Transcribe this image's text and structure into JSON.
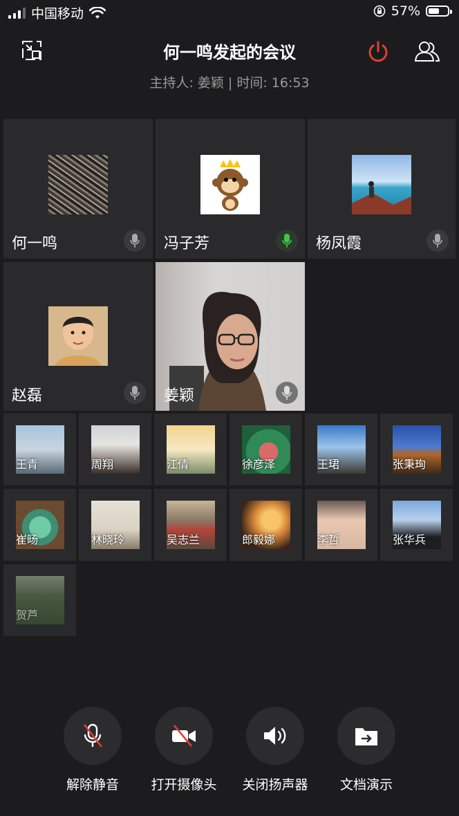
{
  "status_bar": {
    "carrier": "中国移动",
    "battery": "57%",
    "battery_level": 0.57
  },
  "header": {
    "title": "何一鸣发起的会议",
    "subtitle": "主持人: 姜颖 | 时间: 16:53"
  },
  "colors": {
    "accent_red": "#e0412f",
    "active_green": "#3cc84a",
    "bg": "#1c1c1e",
    "tile": "#2a2a2c"
  },
  "main_participants": [
    {
      "name": "何一鸣",
      "mic": "muted"
    },
    {
      "name": "冯子芳",
      "mic": "active"
    },
    {
      "name": "杨凤霞",
      "mic": "muted"
    },
    {
      "name": "赵磊",
      "mic": "muted"
    },
    {
      "name": "姜颖",
      "mic": "muted",
      "video": true
    }
  ],
  "grid_participants": [
    "王青",
    "周翔",
    "江倩",
    "徐彦泽",
    "王珺",
    "张秉珣",
    "崔旸",
    "林晓玲",
    "吴志兰",
    "郎毅娜",
    "李哲",
    "张华兵",
    "贺芦"
  ],
  "controls": [
    {
      "label": "解除静音",
      "icon": "mic-muted-icon"
    },
    {
      "label": "打开摄像头",
      "icon": "camera-off-icon"
    },
    {
      "label": "关闭扬声器",
      "icon": "speaker-icon"
    },
    {
      "label": "文档演示",
      "icon": "share-doc-icon"
    }
  ]
}
